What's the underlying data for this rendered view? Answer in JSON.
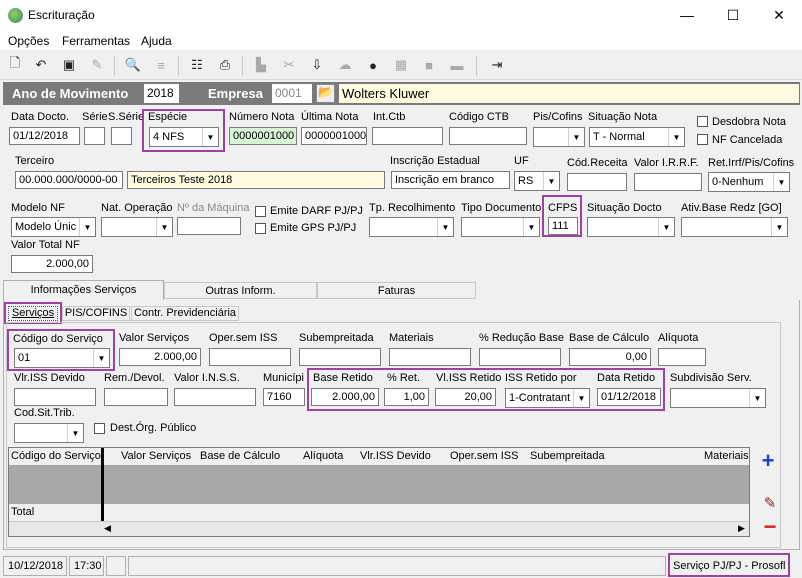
{
  "window": {
    "title": "Escrituração",
    "minimize": "—",
    "maximize": "☐",
    "close": "✕"
  },
  "menu": [
    "Opções",
    "Ferramentas",
    "Ajuda"
  ],
  "header": {
    "ano_label": "Ano de Movimento",
    "ano_value": "2018",
    "empresa_label": "Empresa",
    "empresa_code": "0001",
    "empresa_name": "Wolters Kluwer"
  },
  "row1": {
    "data_docto_label": "Data Docto.",
    "data_docto": "01/12/2018",
    "serie_label": "Série",
    "subserie_label": "S.Série",
    "especie_label": "Espécie",
    "especie": "4 NFS",
    "numero_label": "Número Nota",
    "numero": "0000001000",
    "ultima_label": "Última Nota",
    "ultima": "0000001000",
    "intctb_label": "Int.Ctb",
    "codigo_ctb_label": "Código CTB",
    "piscofins_label": "Pis/Cofins",
    "situacao_label": "Situação Nota",
    "situacao": "T - Normal",
    "desdobra_label": "Desdobra Nota",
    "nf_cancelada_label": "NF Cancelada"
  },
  "row2": {
    "terceiro_label": "Terceiro",
    "terceiro_cnpj": "00.000.000/0000-00",
    "terceiro_nome": "Terceiros Teste 2018",
    "ie_label": "Inscrição Estadual",
    "ie": "Inscrição em branco",
    "uf_label": "UF",
    "uf": "RS",
    "codreceita_label": "Cód.Receita",
    "irrf_label": "Valor I.R.R.F.",
    "ret_label": "Ret.Irrf/Pis/Cofins",
    "ret": "0-Nenhum"
  },
  "row3": {
    "modelo_label": "Modelo NF",
    "modelo": "Modelo Únic",
    "natop_label": "Nat. Operação",
    "maquina_label": "Nº da Máquina",
    "darf_label": "Emite DARF PJ/PJ",
    "gps_label": "Emite GPS PJ/PJ",
    "tprec_label": "Tp. Recolhimento",
    "tipodoc_label": "Tipo Documento",
    "cfps_label": "CFPS",
    "cfps": "111",
    "sitdocto_label": "Situação Docto",
    "ativbase_label": "Ativ.Base Redz [GO]",
    "valortotal_label": "Valor Total NF",
    "valortotal": "2.000,00"
  },
  "tabs": [
    "Informações Serviços",
    "Outras Inform.",
    "Faturas"
  ],
  "subtabs": [
    "Serviços",
    "PIS/COFINS",
    "Contr. Previdenciária"
  ],
  "serv": {
    "codigo_label": "Código do Serviço",
    "codigo": "01",
    "valor_label": "Valor Serviços",
    "valor": "2.000,00",
    "opersem_label": "Oper.sem ISS",
    "subemp_label": "Subempreitada",
    "materiais_label": "Materiais",
    "reducao_label": "% Redução Base",
    "basecalc_label": "Base de Cálculo",
    "basecalc": "0,00",
    "aliquota_label": "Alíquota",
    "vlriss_label": "Vlr.ISS Devido",
    "remdevol_label": "Rem./Devol.",
    "inss_label": "Valor I.N.S.S.",
    "municipio_label": "Municípi",
    "municipio": "7160",
    "baseret_label": "Base Retido",
    "baseret": "2.000,00",
    "pctret_label": "% Ret.",
    "pctret": "1,00",
    "vlissret_label": "Vl.ISS Retido",
    "vlissret": "20,00",
    "issretpor_label": "ISS Retido por",
    "issretpor": "1-Contratant",
    "dataret_label": "Data Retido",
    "dataret": "01/12/2018",
    "subdiv_label": "Subdivisão Serv.",
    "codsit_label": "Cod.Sit.Trib.",
    "destorg_label": "Dest.Órg. Público"
  },
  "grid": {
    "columns": [
      "Código do Serviço",
      "Valor Serviços",
      "Base de Cálculo",
      "Alíquota",
      "Vlr.ISS Devido",
      "Oper.sem ISS",
      "Subempreitada",
      "Materiais"
    ],
    "total_label": "Total"
  },
  "status": {
    "date": "10/12/2018",
    "time": "17:30",
    "module": "Serviço PJ/PJ - Prosofl"
  }
}
